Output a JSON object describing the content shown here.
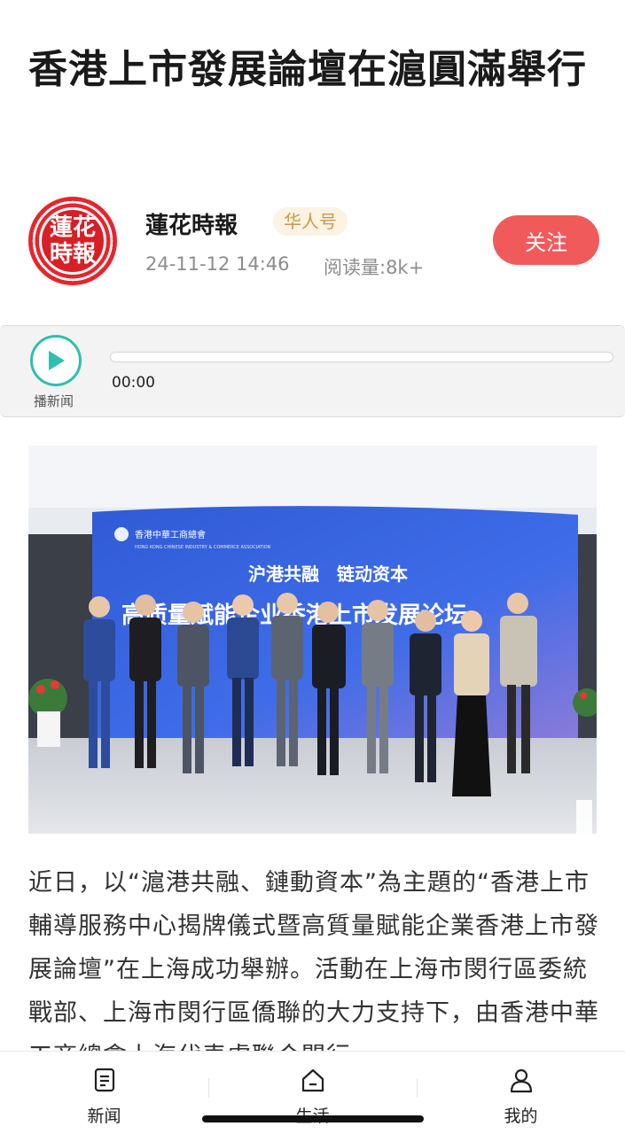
{
  "article": {
    "title": "香港上市發展論壇在滬圓滿舉行",
    "author": {
      "logo_text_top": "蓮花",
      "logo_text_bottom": "時報",
      "name": "蓮花時報",
      "badge": "华人号",
      "date": "24-11-12 14:46",
      "reads": "阅读量:8k+",
      "follow_label": "关注"
    },
    "player": {
      "label": "播新闻",
      "time": "00:00",
      "progress": 0
    },
    "photo": {
      "org_name_cn": "香港中華工商總會",
      "org_name_en": "HONG KONG CHINESE INDUSTRY & COMMERCE ASSOCIATION",
      "backdrop_line1": "沪港共融　链动资本",
      "backdrop_line2": "高质量赋能企业香港上市发展论坛"
    },
    "body": "近日，以“滬港共融、鏈動資本”為主題的“香港上市輔導服務中心揭牌儀式暨高質量賦能企業香港上市發展論壇”在上海成功舉辦。活動在上海市閔行區委統戰部、上海市閔行區僑聯的大力支持下，由香港中華工商總會上海代表處聯合閔行"
  },
  "tabbar": {
    "items": [
      {
        "label": "新闻",
        "icon": "news-icon"
      },
      {
        "label": "生活",
        "icon": "home-icon"
      },
      {
        "label": "我的",
        "icon": "person-icon"
      }
    ]
  },
  "colors": {
    "accent_red": "#f15a5a",
    "badge_gold": "#c89a4a",
    "player_teal": "#2fbfae",
    "logo_red": "#d81f26"
  }
}
